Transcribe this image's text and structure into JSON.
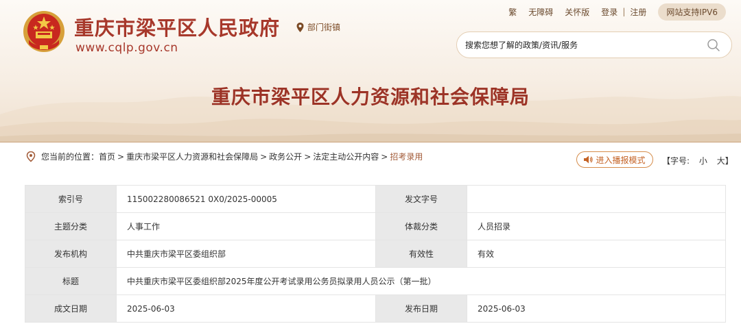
{
  "site": {
    "title": "重庆市梁平区人民政府",
    "url": "www.cqlp.gov.cn",
    "location_link": "部门街镇"
  },
  "toplinks": {
    "traditional": "繁",
    "accessible": "无障碍",
    "care": "关怀版",
    "login": "登录",
    "separator": "|",
    "register": "注册",
    "ipv6": "网站支持IPV6"
  },
  "search": {
    "placeholder": "搜索您想了解的政策/资讯/服务"
  },
  "department": {
    "title": "重庆市梁平区人力资源和社会保障局"
  },
  "breadcrumb": {
    "prefix": "您当前的位置：",
    "separator": ">",
    "items": [
      "首页",
      "重庆市梁平区人力资源和社会保障局",
      "政务公开",
      "法定主动公开内容",
      "招考录用"
    ]
  },
  "tools": {
    "broadcast": "进入播报模式",
    "font_open": "【字号:",
    "font_small": "小",
    "font_large": "大】"
  },
  "meta": {
    "rows": [
      {
        "k1": "索引号",
        "v1": "115002280086521 0X0/2025-00005",
        "k2": "发文字号",
        "v2": ""
      },
      {
        "k1": "主题分类",
        "v1": "人事工作",
        "k2": "体裁分类",
        "v2": "人员招录"
      },
      {
        "k1": "发布机构",
        "v1": "中共重庆市梁平区委组织部",
        "k2": "有效性",
        "v2": "有效"
      },
      {
        "k1": "标题",
        "v1": "中共重庆市梁平区委组织部2025年度公开考试录用公务员拟录用人员公示（第一批）"
      },
      {
        "k1": "成文日期",
        "v1": "2025-06-03",
        "k2": "发布日期",
        "v2": "2025-06-03"
      }
    ]
  },
  "colors": {
    "brand": "#a7382b",
    "accent": "#c46224"
  },
  "icons": {
    "emblem": "national-emblem-icon",
    "pin": "map-pin-icon",
    "search": "search-icon",
    "speaker": "speaker-icon"
  }
}
